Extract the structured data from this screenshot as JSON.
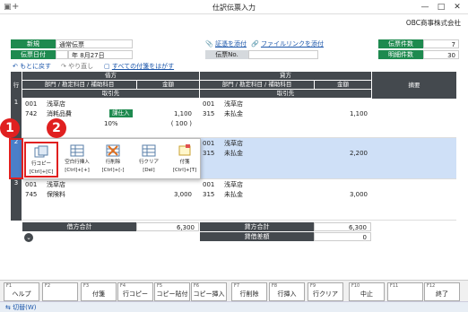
{
  "window": {
    "title": "仕訳伝票入力",
    "min": "—",
    "max": "□",
    "close": "✕",
    "plus": "+"
  },
  "company": "OBC商事株式会社",
  "header": {
    "mode": "新規",
    "type": "通常伝票",
    "date_label": "伝票日付",
    "era": "年",
    "date": "8月27日",
    "attach": "証憑を添付",
    "link": "ファイルリンクを添付",
    "voucher_no_label": "伝票No.",
    "count_label": "伝票件数",
    "count": "7",
    "lines_label": "明細件数",
    "lines": "30"
  },
  "nav": {
    "back": "もとに戻す",
    "redo": "やり直し",
    "select_all": "すべての付箋をはがす"
  },
  "grid": {
    "row_label": "行",
    "debit": "借方",
    "credit": "貸方",
    "memo": "摘要",
    "dept": "部門 / 勘定科目 / 補助科目",
    "amount": "金額",
    "partner": "取引先",
    "rows": [
      {
        "no": "1",
        "d_code1": "001",
        "d_name1": "浅草店",
        "d_code2": "742",
        "d_name2": "消耗品費",
        "d_badge": "課仕入",
        "d_amt": "1,100",
        "d_tax": "( 100 )",
        "d_rate": "10%",
        "c_code1": "001",
        "c_name1": "浅草店",
        "c_code2": "315",
        "c_name2": "未払金",
        "c_amt": "1,100"
      },
      {
        "no": "2",
        "c_code1": "001",
        "c_name1": "浅草店",
        "c_code2": "315",
        "c_name2": "未払金",
        "c_amt": "2,200"
      },
      {
        "no": "3",
        "d_code1": "001",
        "d_name1": "浅草店",
        "d_code2": "745",
        "d_name2": "保険料",
        "d_amt": "3,000",
        "c_code1": "001",
        "c_name1": "浅草店",
        "c_code2": "315",
        "c_name2": "未払金",
        "c_amt": "3,000"
      }
    ]
  },
  "popup": [
    {
      "label": "行コピー",
      "key": "[Ctrl]+[C]"
    },
    {
      "label": "空白行挿入",
      "key": "[Ctrl]+[+]"
    },
    {
      "label": "行削除",
      "key": "[Ctrl]+[-]"
    },
    {
      "label": "行クリア",
      "key": "[Del]"
    },
    {
      "label": "付箋",
      "key": "[Ctrl]+[T]"
    }
  ],
  "callouts": [
    "1",
    "2"
  ],
  "totals": {
    "debit_label": "借方合計",
    "debit": "6,300",
    "credit_label": "貸方合計",
    "credit": "6,300",
    "diff_label": "貸借差額",
    "diff": "0"
  },
  "fkeys": [
    {
      "key": "F1",
      "label": "ヘルプ"
    },
    {
      "key": "F2",
      "label": ""
    },
    {
      "key": "F3",
      "label": "付箋"
    },
    {
      "key": "F4",
      "label": "行コピー"
    },
    {
      "key": "F5",
      "label": "コピー貼付"
    },
    {
      "key": "F6",
      "label": "コピー挿入"
    },
    {
      "key": "F7",
      "label": "行削除"
    },
    {
      "key": "F8",
      "label": "行挿入"
    },
    {
      "key": "F9",
      "label": "行クリア"
    },
    {
      "key": "F10",
      "label": "中止"
    },
    {
      "key": "F11",
      "label": ""
    },
    {
      "key": "F12",
      "label": "終了"
    }
  ],
  "taskbar": {
    "switch": "切替(W)"
  },
  "colors": {
    "accent": "#1e8a4f",
    "selected": "#cfe0f7",
    "callout": "#e02020"
  }
}
